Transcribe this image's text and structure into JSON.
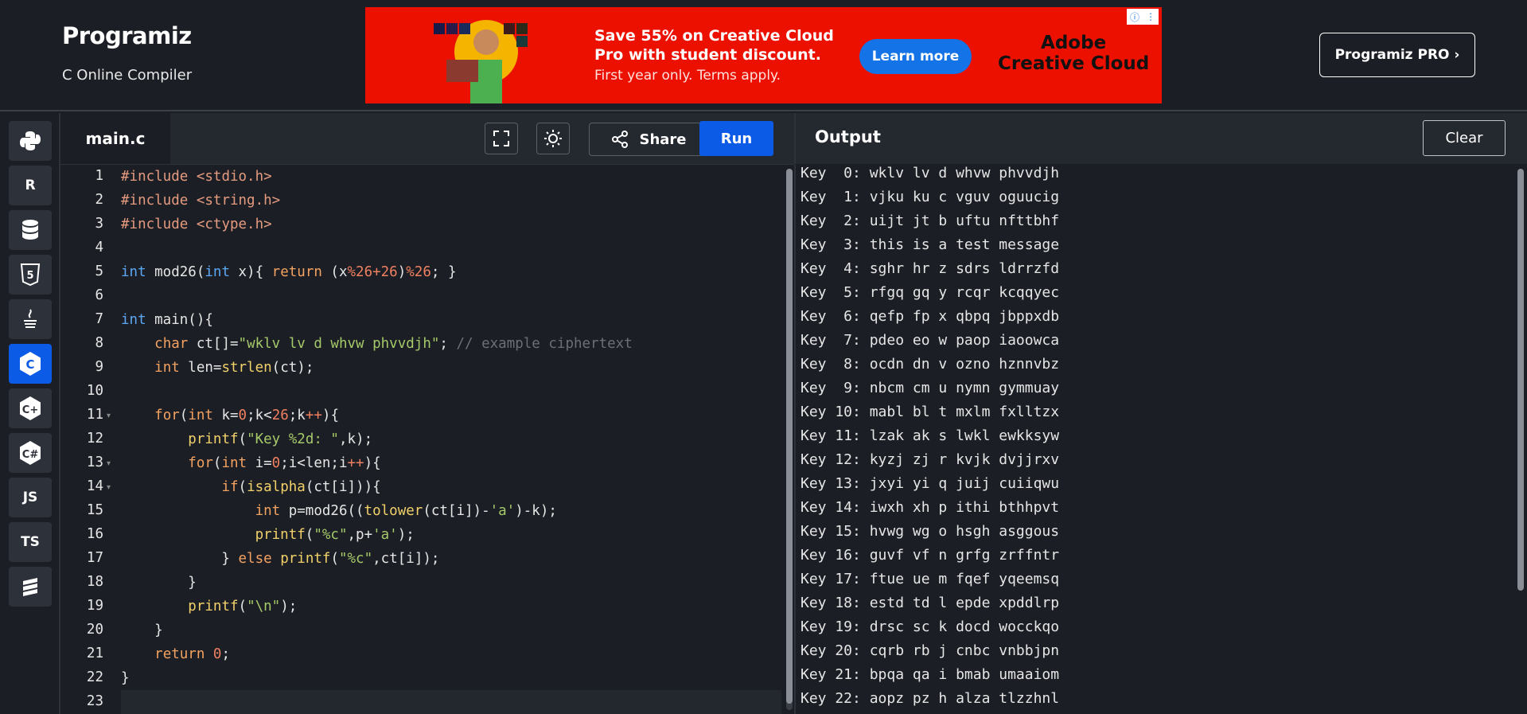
{
  "header": {
    "logo": "Programiz",
    "subtitle": "C Online Compiler",
    "pro_button": "Programiz PRO ›"
  },
  "ad": {
    "headline": "Save 55% on Creative Cloud Pro with student discount.",
    "subtext": "First year only. Terms apply.",
    "cta": "Learn more",
    "brand_line1": "Adobe",
    "brand_line2": "Creative Cloud",
    "info_icon": "info-icon",
    "menu_icon": "kebab-icon"
  },
  "sidebar": {
    "languages": [
      {
        "name": "python-icon",
        "label": ""
      },
      {
        "name": "r-icon",
        "label": "R"
      },
      {
        "name": "database-icon",
        "label": ""
      },
      {
        "name": "html5-icon",
        "label": "5"
      },
      {
        "name": "java-icon",
        "label": ""
      },
      {
        "name": "c-icon",
        "label": "C",
        "active": true
      },
      {
        "name": "cpp-icon",
        "label": "C+"
      },
      {
        "name": "csharp-icon",
        "label": "C#"
      },
      {
        "name": "javascript-icon",
        "label": "JS"
      },
      {
        "name": "typescript-icon",
        "label": "TS"
      },
      {
        "name": "swift-icon",
        "label": ""
      }
    ]
  },
  "editor": {
    "tab": "main.c",
    "share_label": "Share",
    "run_label": "Run",
    "line_numbers": [
      "1",
      "2",
      "3",
      "4",
      "5",
      "6",
      "7",
      "8",
      "9",
      "10",
      "11",
      "12",
      "13",
      "14",
      "15",
      "16",
      "17",
      "18",
      "19",
      "20",
      "21",
      "22",
      "23"
    ]
  },
  "output": {
    "title": "Output",
    "clear_label": "Clear",
    "lines": [
      "Key  0: wklv lv d whvw phvvdjh",
      "Key  1: vjku ku c vguv oguucig",
      "Key  2: uijt jt b uftu nfttbhf",
      "Key  3: this is a test message",
      "Key  4: sghr hr z sdrs ldrrzfd",
      "Key  5: rfgq gq y rcqr kcqqyec",
      "Key  6: qefp fp x qbpq jbppxdb",
      "Key  7: pdeo eo w paop iaoowca",
      "Key  8: ocdn dn v ozno hznnvbz",
      "Key  9: nbcm cm u nymn gymmuay",
      "Key 10: mabl bl t mxlm fxlltzx",
      "Key 11: lzak ak s lwkl ewkksyw",
      "Key 12: kyzj zj r kvjk dvjjrxv",
      "Key 13: jxyi yi q juij cuiiqwu",
      "Key 14: iwxh xh p ithi bthhpvt",
      "Key 15: hvwg wg o hsgh asggous",
      "Key 16: guvf vf n grfg zrffntr",
      "Key 17: ftue ue m fqef yqeemsq",
      "Key 18: estd td l epde xpddlrp",
      "Key 19: drsc sc k docd wocckqo",
      "Key 20: cqrb rb j cnbc vnbbjpn",
      "Key 21: bpqa qa i bmab umaaiom",
      "Key 22: aopz pz h alza tlzzhnl"
    ]
  },
  "colors": {
    "run": "#0b5be6",
    "background": "#1b1e24",
    "ad_red": "#eb1000"
  }
}
